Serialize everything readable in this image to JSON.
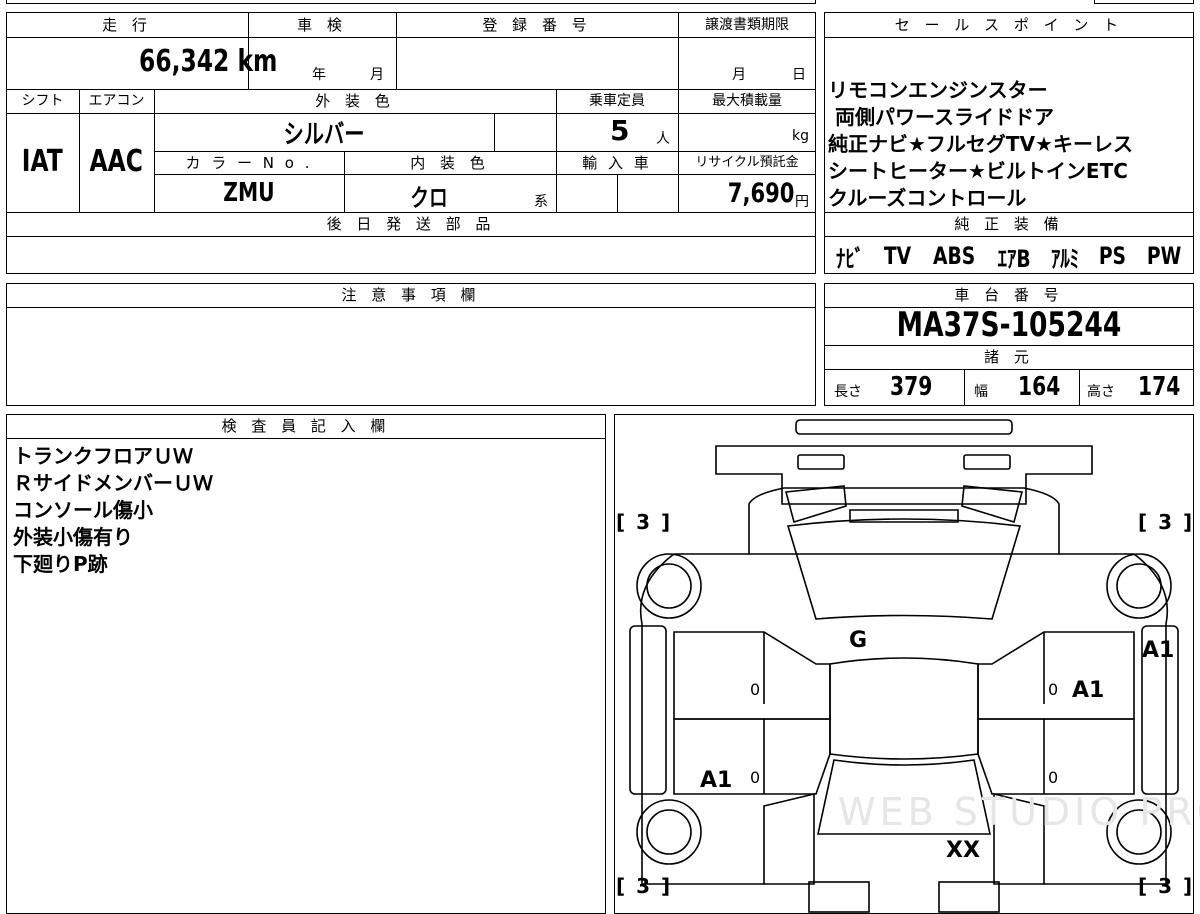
{
  "top_form": {
    "headers": {
      "mileage": "走 行",
      "shaken": "車 検",
      "registration_no": "登 録 番 号",
      "transfer_deadline": "譲渡書類期限",
      "shift": "シフト",
      "aircon": "エアコン",
      "exterior_color": "外 装 色",
      "capacity": "乗車定員",
      "max_load": "最大積載量",
      "color_no": "カ ラ ー N o .",
      "interior_color": "内 装 色",
      "import": "輸 入 車",
      "recycle_fee": "リサイクル預託金",
      "later_parts": "後 日 発 送 部 品"
    },
    "mileage": "66,342 km",
    "shaken_year_label": "年",
    "shaken_month_label": "月",
    "transfer_month_label": "月",
    "transfer_day_label": "日",
    "shift": "IAT",
    "aircon": "AAC",
    "exterior_color": "シルバー",
    "capacity": "5",
    "capacity_unit": "人",
    "max_load_unit": "kg",
    "color_no": "ZMU",
    "interior_color": "クロ",
    "interior_suffix": "系",
    "recycle_fee": "7,690",
    "recycle_unit": "円"
  },
  "sales_points": {
    "header": "セ ー ル ス ポ イ ン ト",
    "lines": [
      "リモコンエンジンスター",
      " 両側パワースライドドア",
      "純正ナビ★フルセグTV★キーレス",
      "シートヒーター★ビルトインETC",
      "クルーズコントロール"
    ]
  },
  "factory_equipment": {
    "header": "純 正 装 備",
    "items": [
      "ﾅﾋﾞ",
      "TV",
      "ABS",
      "ｴｱB",
      "ｱﾙﾐ",
      "PS",
      "PW"
    ]
  },
  "notes": {
    "header": "注 意 事 項 欄"
  },
  "chassis": {
    "header": "車 台 番 号",
    "number": "MA37S-105244",
    "specs_header": "諸 元",
    "length_label": "長さ",
    "length": "379",
    "width_label": "幅",
    "width": "164",
    "height_label": "高さ",
    "height": "174"
  },
  "inspector": {
    "header": "検 査 員 記 入 欄",
    "lines": [
      "トランクフロアＵＷ",
      "ＲサイドメンバーＵＷ",
      "コンソール傷小",
      "外装小傷有り",
      "下廻りP跡"
    ]
  },
  "diagram": {
    "tire_grade": "[ 3 ]",
    "marks": {
      "windshield": "G",
      "right_front": "A1",
      "right_front_door": "A1",
      "left_rear_door": "A1",
      "roof_rear": "XX"
    },
    "panel_zero": "0",
    "watermark": "WEB STUDIO PRO"
  }
}
